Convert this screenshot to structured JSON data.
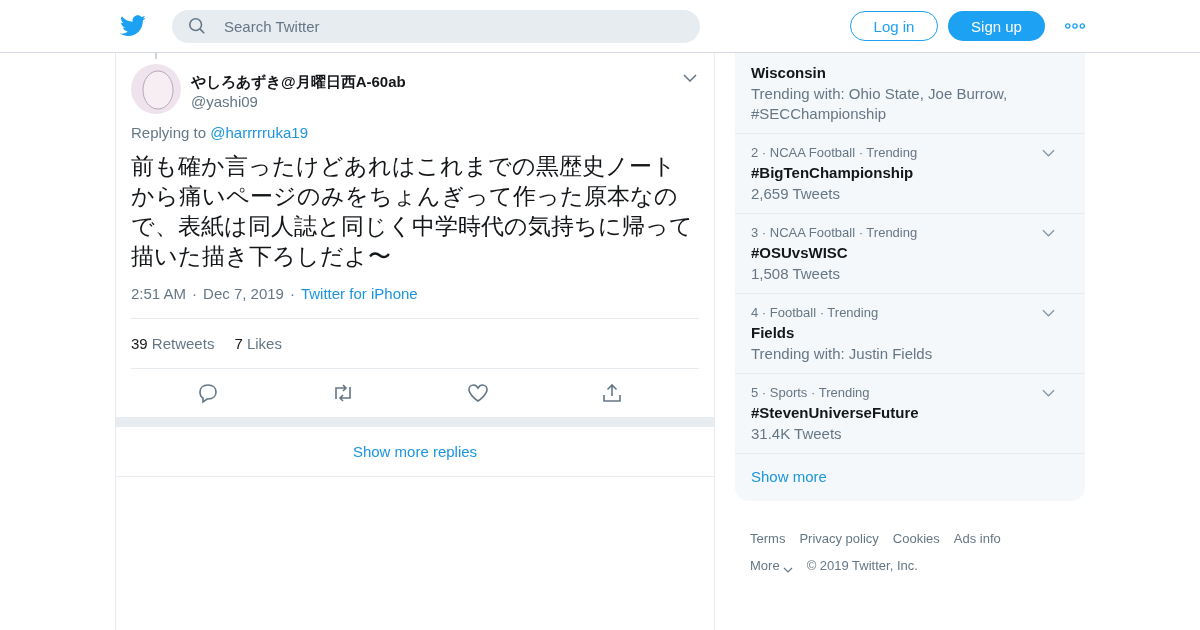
{
  "header": {
    "search": {
      "placeholder": "Search Twitter"
    },
    "login": "Log in",
    "signup": "Sign up"
  },
  "tweet": {
    "name": "やしろあずき@月曜日西A-60ab",
    "handle": "@yashi09",
    "replying_label": "Replying to",
    "replying_to": "@harrrrruka19",
    "text": "前も確か言ったけどあれはこれまでの黒歴史ノートから痛いページのみをちょんぎって作った原本なので、表紙は同人誌と同じく中学時代の気持ちに帰って描いた描き下ろしだよ〜",
    "time": "2:51 AM",
    "separator": "·",
    "date": "Dec 7, 2019",
    "source": "Twitter for iPhone",
    "stats": [
      {
        "count": "39",
        "label": "Retweets"
      },
      {
        "count": "7",
        "label": "Likes"
      }
    ]
  },
  "show_more_replies": "Show more replies",
  "trends": [
    {
      "name": "Wisconsin",
      "detail": "Trending with: Ohio State, Joe Burrow, #SECChampionship"
    },
    {
      "meta": "2 · NCAA Football · Trending",
      "name": "#BigTenChampionship",
      "detail": "2,659 Tweets"
    },
    {
      "meta": "3 · NCAA Football · Trending",
      "name": "#OSUvsWISC",
      "detail": "1,508 Tweets"
    },
    {
      "meta": "4 · Football · Trending",
      "name": "Fields",
      "detail": "Trending with: Justin Fields"
    },
    {
      "meta": "5 · Sports · Trending",
      "name": "#StevenUniverseFuture",
      "detail": "31.4K Tweets"
    }
  ],
  "show_more": "Show more",
  "footer": {
    "links": [
      "Terms",
      "Privacy policy",
      "Cookies",
      "Ads info"
    ],
    "more": "More",
    "copyright": "© 2019 Twitter, Inc."
  }
}
